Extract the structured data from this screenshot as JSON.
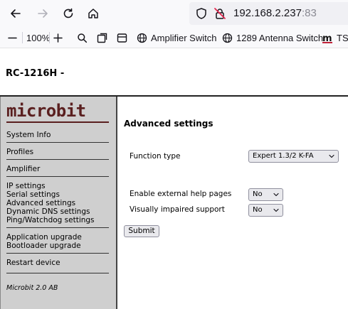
{
  "browser": {
    "url_host": "192.168.2.237",
    "url_port": ":83",
    "zoom": "100%",
    "bookmarks": [
      "Amplifier Switch",
      "1289 Antenna Switch",
      "TS-"
    ],
    "icons": [
      "back-arrow-icon",
      "forward-arrow-icon",
      "reload-icon",
      "home-icon",
      "shield-icon",
      "insecure-lock-icon",
      "zoom-out-icon",
      "zoom-in-icon",
      "search-icon",
      "screenshot-icon",
      "sidebar-icon",
      "globe-icon"
    ]
  },
  "page": {
    "title": "RC-1216H -"
  },
  "sidebar": {
    "logo": "microbit",
    "items": [
      "System Info",
      "Profiles",
      "Amplifier",
      "IP settings",
      "Serial settings",
      "Advanced settings",
      "Dynamic DNS settings",
      "Ping/Watchdog settings",
      "Application upgrade",
      "Bootloader upgrade",
      "Restart device"
    ],
    "footer": "Microbit 2.0 AB"
  },
  "main": {
    "section_title": "Advanced settings",
    "function_type": {
      "label": "Function type",
      "value": "Expert 1.3/2 K-FA"
    },
    "external_help": {
      "label": "Enable external help pages",
      "value": "No"
    },
    "visually_impaired": {
      "label": "Visually impaired support",
      "value": "No"
    },
    "submit_label": "Submit"
  },
  "colors": {
    "logo": "#5a1f1f",
    "sidebar_bg": "#cfcfcf",
    "control_bg": "#e9e9ed"
  }
}
